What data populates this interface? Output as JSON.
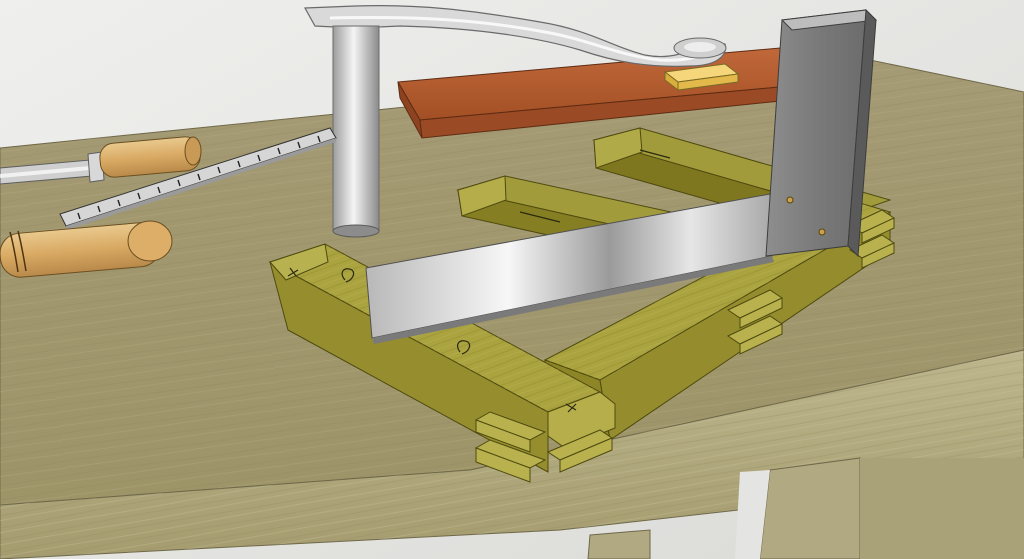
{
  "scene": {
    "kind": "3d-render",
    "subject": "woodworking-bench",
    "objects": [
      "workbench",
      "chisel",
      "steel-rule",
      "file",
      "bowsaw-frame",
      "board",
      "sanding-block",
      "mortise-tenon-frame",
      "try-square"
    ]
  },
  "colors": {
    "wall": "#e8e8e6",
    "bench_top": "#a39b75",
    "bench_front": "#b3ad85",
    "frame_wood": "#a7a03e",
    "frame_dark": "#857c1e",
    "board": "#b45c2f",
    "metal_light": "#f2f2f2",
    "metal_dark": "#8a8a8a",
    "handle_wood": "#e0b870",
    "stock_grey": "#7d7d7d"
  }
}
